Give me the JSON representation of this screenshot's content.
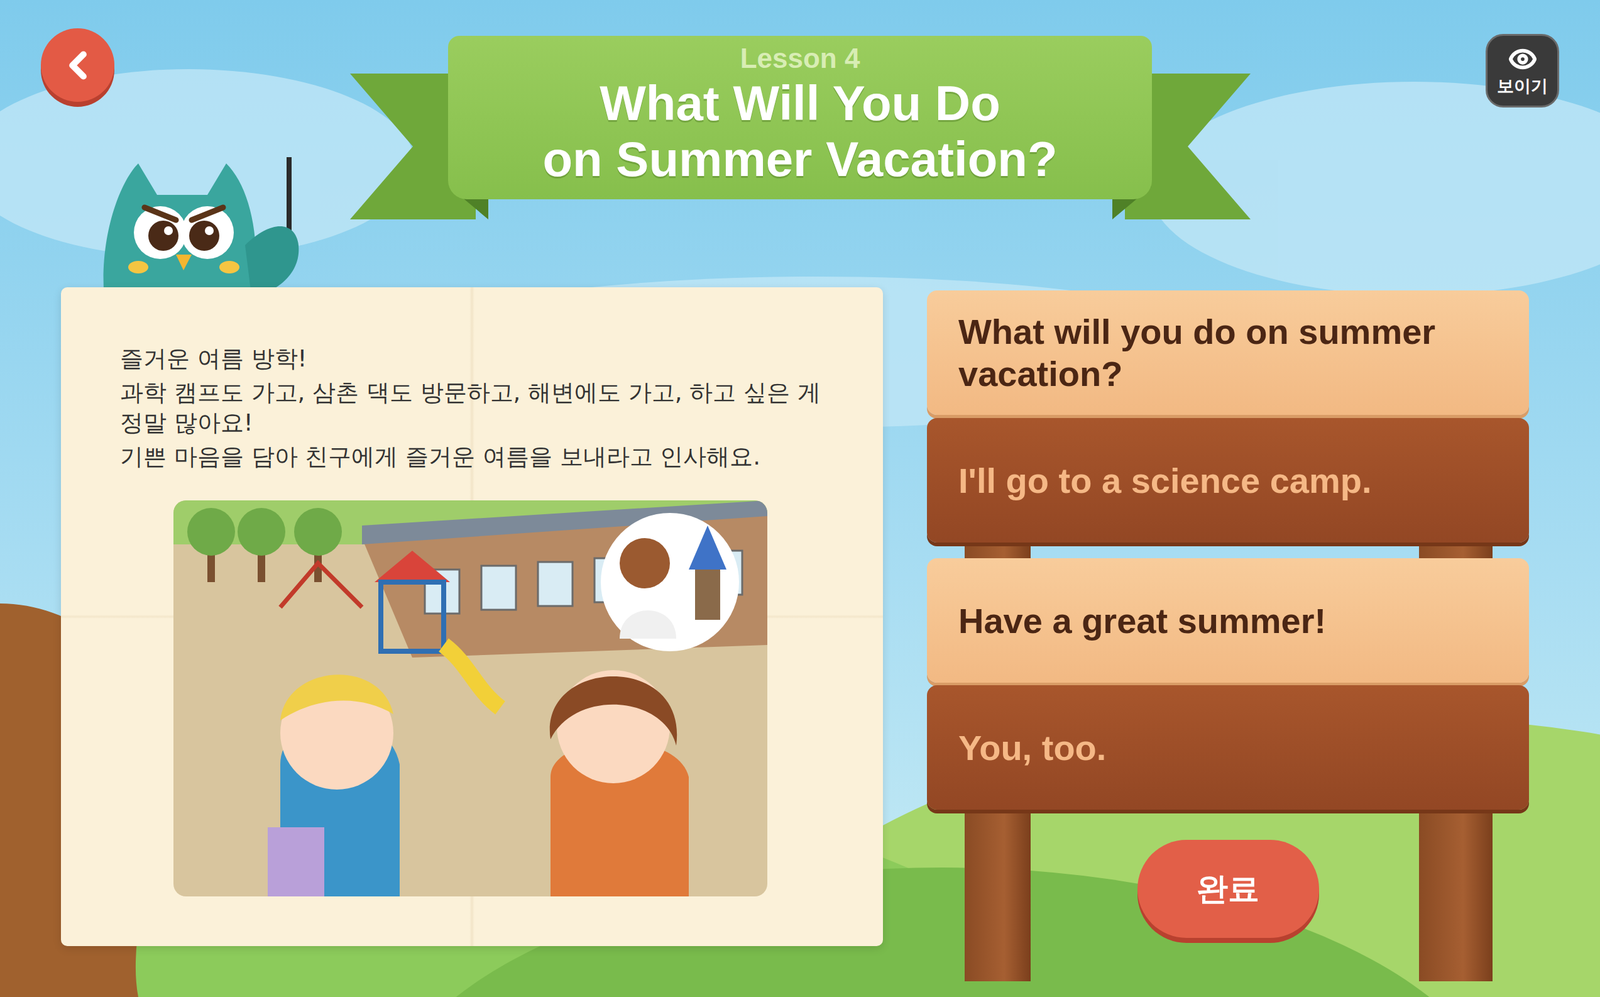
{
  "header": {
    "lesson": "Lesson 4",
    "title_lines": [
      "What Will You Do",
      "on Summer Vacation?"
    ]
  },
  "show_button": {
    "label": "보이기"
  },
  "intro": {
    "lines": [
      "즐거운 여름 방학!",
      "과학 캠프도 가고, 삼촌 댁도 방문하고, 해변에도 가고, 하고 싶은 게 정말 많아요!",
      "기쁜 마음을 담아 친구에게 즐거운 여름을 보내라고 인사해요."
    ]
  },
  "dialogue": [
    {
      "text": "What will you do on summer vacation?",
      "kind": "light"
    },
    {
      "text": "I'll go to a science camp.",
      "kind": "dark"
    },
    {
      "text": "Have a great summer!",
      "kind": "light"
    },
    {
      "text": "You, too.",
      "kind": "dark"
    }
  ],
  "done_button": {
    "label": "완료"
  }
}
